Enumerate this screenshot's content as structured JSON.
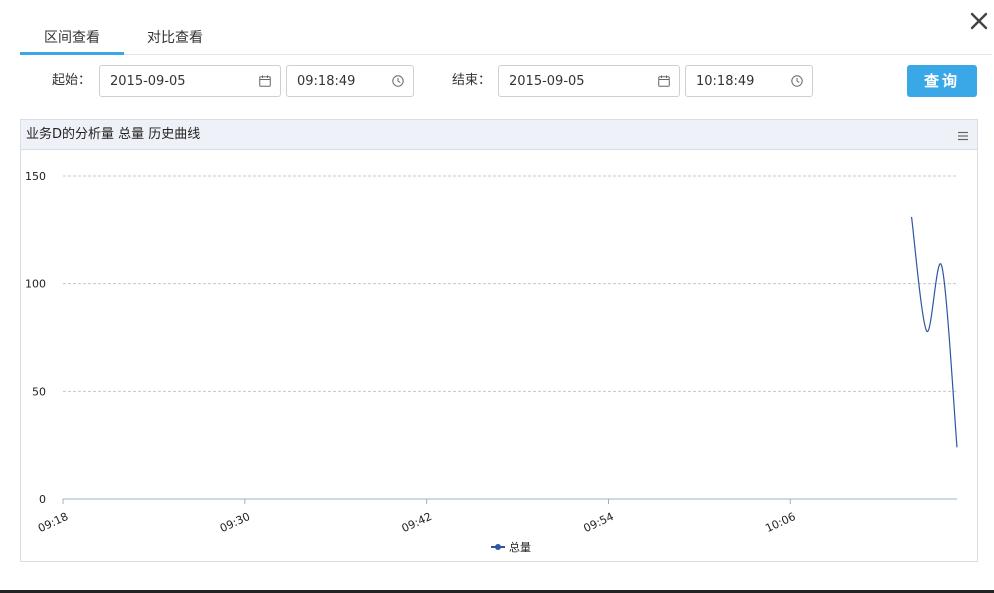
{
  "tabs": [
    {
      "label": "区间查看",
      "active": true
    },
    {
      "label": "对比查看",
      "active": false
    }
  ],
  "filters": {
    "start_label": "起始：",
    "start_date": "2015-09-05",
    "start_time": "09:18:49",
    "end_label": "结束：",
    "end_date": "2015-09-05",
    "end_time": "10:18:49",
    "query_label": "查询"
  },
  "icons": {
    "close": "close-icon",
    "calendar": "calendar-icon",
    "clock": "clock-icon",
    "menu": "hamburger-menu-icon"
  },
  "colors": {
    "accent": "#3aa7e6",
    "series": "#2f55a4"
  },
  "chart_data": {
    "type": "line",
    "title": "业务D的分析量 总量 历史曲线",
    "xlabel": "",
    "ylabel": "",
    "x_ticks": [
      "09:18",
      "09:30",
      "09:42",
      "09:54",
      "10:06"
    ],
    "x_range": [
      "09:18:00",
      "10:17:00"
    ],
    "y_ticks": [
      0,
      50,
      100,
      150
    ],
    "ylim": [
      0,
      150
    ],
    "grid": true,
    "legend": "bottom-center",
    "series": [
      {
        "name": "总量",
        "x": [
          "10:14:00",
          "10:15:00",
          "10:16:00",
          "10:17:00"
        ],
        "y": [
          131,
          78,
          108,
          24
        ]
      }
    ]
  }
}
